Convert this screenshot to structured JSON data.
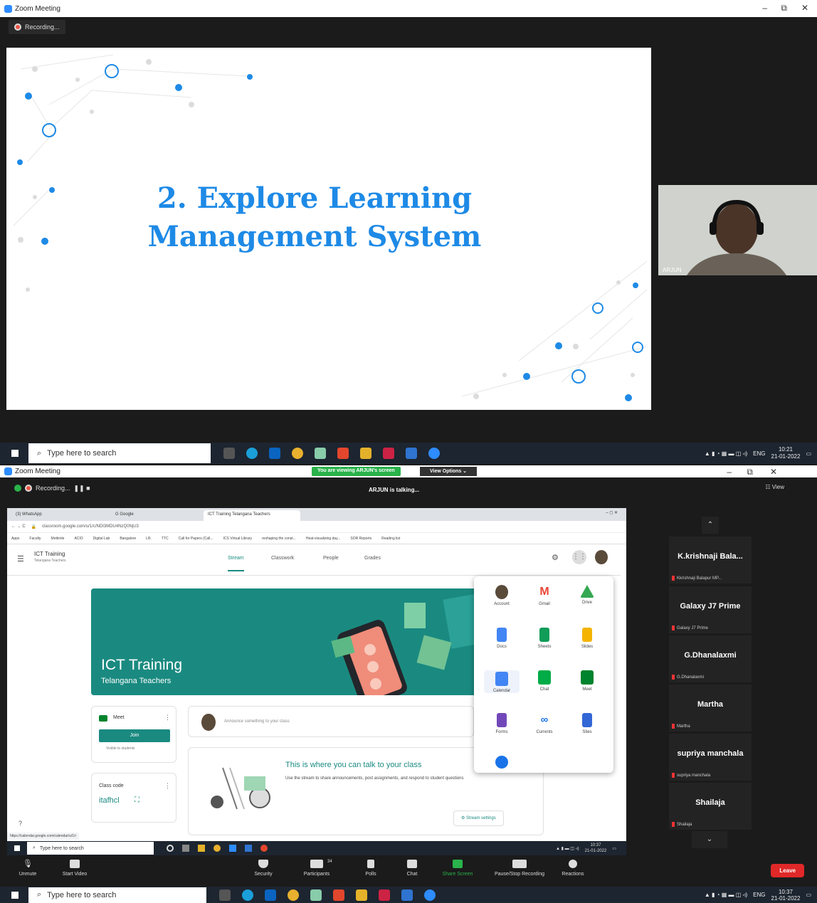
{
  "window1": {
    "title": "Zoom Meeting",
    "recording_label": "Recording...",
    "slide_title_line1": "2. Explore Learning",
    "slide_title_line2": "Management System",
    "camera_name": "ARJUN",
    "win_minimize": "–",
    "win_restore": "⧉",
    "win_close": "✕"
  },
  "taskbar1": {
    "search_placeholder": "Type here to search",
    "lang": "ENG",
    "time": "10:21",
    "date": "21-01-2022"
  },
  "window2": {
    "title": "Zoom Meeting",
    "viewing_banner": "You are viewing ARJUN's screen",
    "view_options": "View Options ⌄",
    "recording_label": "Recording...",
    "talking": "ARJUN is talking...",
    "view_button": "View"
  },
  "browser": {
    "tabs": [
      "(3) WhatsApp",
      "G Google",
      "ICT Training Telangana Teachers"
    ],
    "url": "classroom.google.com/u/1/c/NDI3MDU4NzQ0NjU3",
    "bookmarks": [
      "Apps",
      "Faculty",
      "Mettimle",
      "ACIO",
      "Digital Lab",
      "Bangalore",
      "LR.",
      "TTC",
      "Call for Papers (Call...",
      "ICS Virtual Library",
      "reshaping the const...",
      "Heat-visualizing day...",
      "SOR Reports",
      "Reading list"
    ]
  },
  "classroom": {
    "class_name": "ICT Training",
    "class_section": "Telangana Teachers",
    "tabs": [
      "Stream",
      "Classwork",
      "People",
      "Grades"
    ],
    "banner_title": "ICT Training",
    "banner_subtitle": "Telangana Teachers",
    "meet_label": "Meet",
    "join_label": "Join",
    "visible_label": "Visible to students",
    "class_code_label": "Class code",
    "class_code": "itafhcl",
    "announce_placeholder": "Announce something to your class",
    "talk_title": "This is where you can talk to your class",
    "talk_body": "Use the stream to share announcements, post assignments, and respond to student questions",
    "stream_settings": "Stream settings",
    "status_url": "https://calendar.google.com/calendar/u/1/r"
  },
  "apps": [
    {
      "name": "Account",
      "color": "#5a4a3a"
    },
    {
      "name": "Gmail",
      "color": "#ea4335"
    },
    {
      "name": "Drive",
      "color": "#34a853"
    },
    {
      "name": "Docs",
      "color": "#4285f4"
    },
    {
      "name": "Sheets",
      "color": "#0f9d58"
    },
    {
      "name": "Slides",
      "color": "#f4b400"
    },
    {
      "name": "Calendar",
      "color": "#4285f4"
    },
    {
      "name": "Chat",
      "color": "#00ac47"
    },
    {
      "name": "Meet",
      "color": "#00832d"
    },
    {
      "name": "Forms",
      "color": "#7248b9"
    },
    {
      "name": "Currents",
      "color": "#1a73e8"
    },
    {
      "name": "Sites",
      "color": "#3367d6"
    }
  ],
  "inner_taskbar": {
    "search_placeholder": "Type here to search",
    "time": "10:37",
    "date": "21-01-2022"
  },
  "participants": [
    {
      "name": "K.krishnaji Bala...",
      "sub": "Kkrishnaji Balapur MP..."
    },
    {
      "name": "Galaxy J7 Prime",
      "sub": "Galaxy J7 Prime"
    },
    {
      "name": "G.Dhanalaxmi",
      "sub": "G.Dhanalaxmi"
    },
    {
      "name": "Martha",
      "sub": "Martha"
    },
    {
      "name": "supriya manchala",
      "sub": "supriya manchala"
    },
    {
      "name": "Shailaja",
      "sub": "Shailaja"
    }
  ],
  "controls": {
    "unmute": "Unmute",
    "start_video": "Start Video",
    "security": "Security",
    "participants": "Participants",
    "participants_count": "34",
    "polls": "Polls",
    "chat": "Chat",
    "share_screen": "Share Screen",
    "pause_recording": "Pause/Stop Recording",
    "reactions": "Reactions",
    "leave": "Leave"
  },
  "taskbar2": {
    "search_placeholder": "Type here to search",
    "lang": "ENG",
    "time": "10:37",
    "date": "21-01-2022"
  },
  "colors": {
    "zoom_blue": "#2d8cff",
    "slide_blue": "#1e8ae6",
    "classroom_teal": "#1a8a80",
    "leave_red": "#e02828",
    "share_green": "#2ab24b"
  }
}
